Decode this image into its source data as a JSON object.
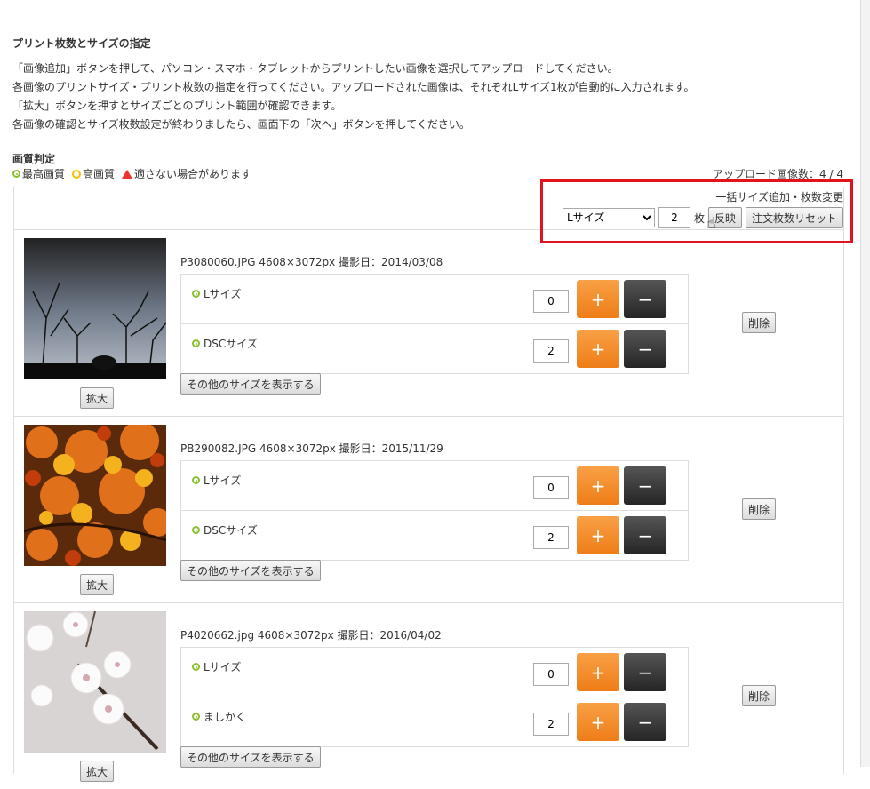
{
  "header": {
    "title": "プリント枚数とサイズの指定",
    "intro": [
      "「画像追加」ボタンを押して、パソコン・スマホ・タブレットからプリントしたい画像を選択してアップロードしてください。",
      "各画像のプリントサイズ・プリント枚数の指定を行ってください。アップロードされた画像は、それぞれLサイズ1枚が自動的に入力されます。",
      "「拡大」ボタンを押すとサイズごとのプリント範囲が確認できます。",
      "各画像の確認とサイズ枚数設定が終わりましたら、画面下の「次へ」ボタンを押してください。"
    ]
  },
  "quality": {
    "heading": "画質判定",
    "best": "最高画質",
    "high": "高画質",
    "warn": "適さない場合があります"
  },
  "upload_count": "アップロード画像数：4 / 4",
  "bulk": {
    "title": "一括サイズ追加・枚数変更",
    "size_selected": "Lサイズ",
    "qty": "2",
    "unit": "枚",
    "apply": "反映",
    "reset": "注文枚数リセット"
  },
  "common": {
    "plus": "+",
    "minus": "−",
    "zoom": "拡大",
    "delete": "削除",
    "other": "その他のサイズを表示する"
  },
  "photos": [
    {
      "meta": "P3080060.JPG 4608×3072px 撮影日：2014/03/08",
      "sizes": [
        {
          "label": "Lサイズ",
          "qty": "0"
        },
        {
          "label": "DSCサイズ",
          "qty": "2"
        }
      ]
    },
    {
      "meta": "PB290082.JPG 4608×3072px 撮影日：2015/11/29",
      "sizes": [
        {
          "label": "Lサイズ",
          "qty": "0"
        },
        {
          "label": "DSCサイズ",
          "qty": "2"
        }
      ]
    },
    {
      "meta": "P4020662.jpg 4608×3072px 撮影日：2016/04/02",
      "sizes": [
        {
          "label": "Lサイズ",
          "qty": "0"
        },
        {
          "label": "ましかく",
          "qty": "2"
        }
      ]
    }
  ]
}
